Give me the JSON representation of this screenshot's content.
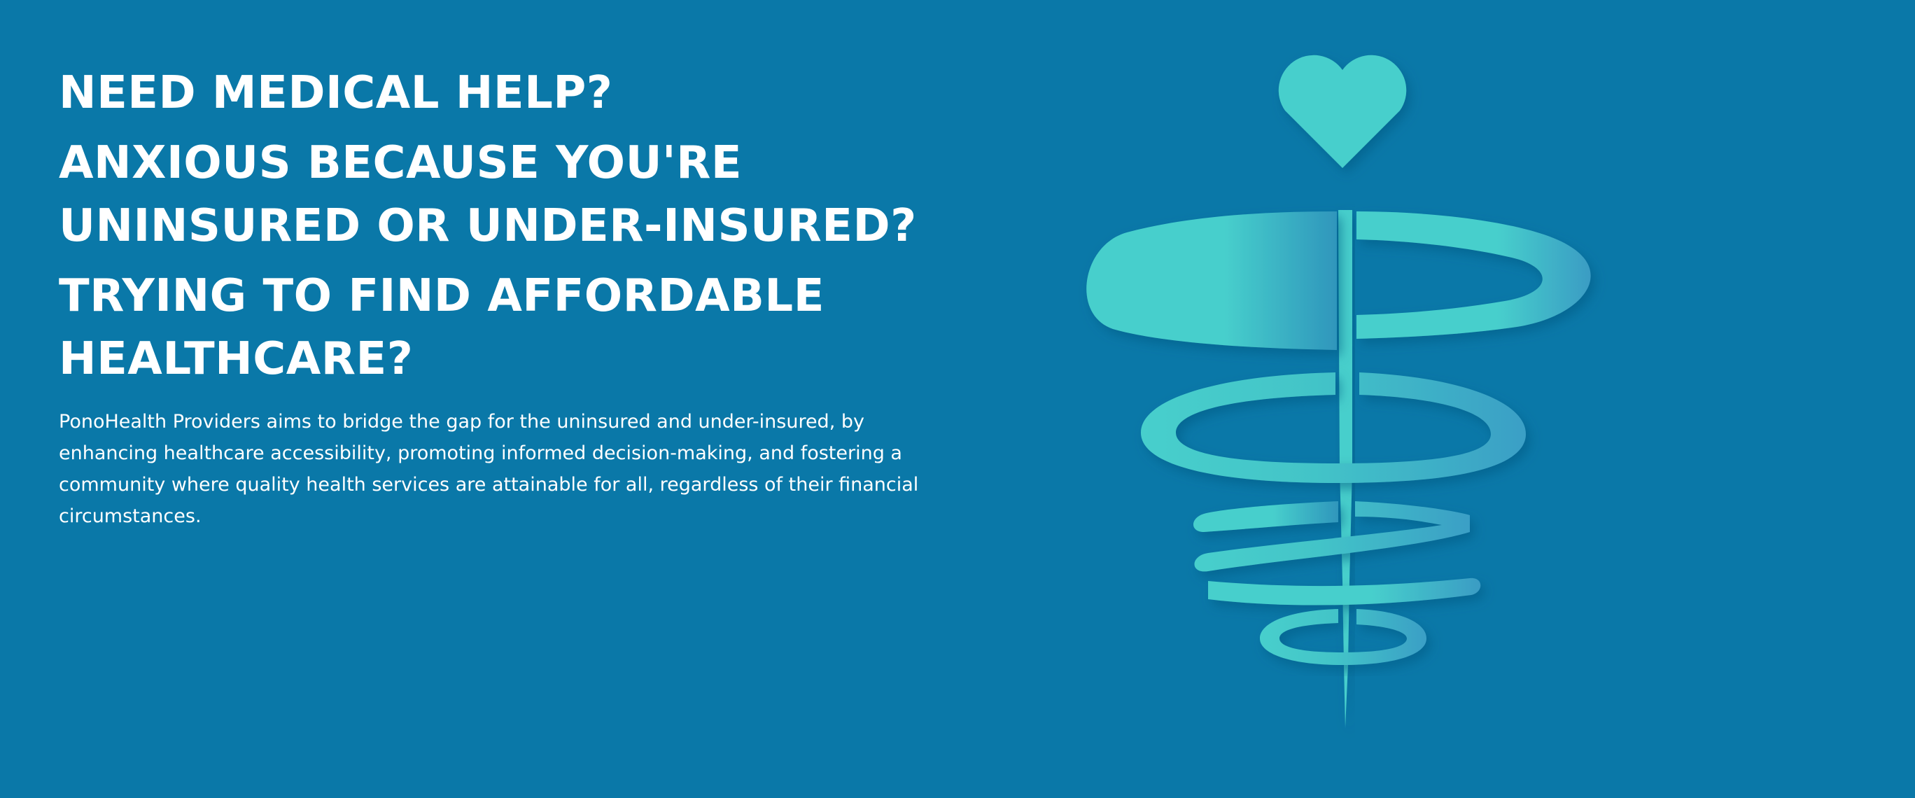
{
  "hero": {
    "headlines": [
      "NEED MEDICAL HELP?",
      "ANXIOUS BECAUSE YOU'RE UNINSURED OR UNDER-INSURED?",
      "TRYING TO FIND AFFORDABLE HEALTHCARE?"
    ],
    "description": "PonoHealth Providers aims to bridge the gap for the uninsured and under-insured, by enhancing healthcare accessibility, promoting informed decision-making, and fostering a community where quality health services are attainable for all, regardless of their financial circumstances."
  },
  "colors": {
    "background": "#0a78a8",
    "logo_teal": "#47cfcc",
    "logo_shadow": "#2a8fb4",
    "text": "#ffffff"
  },
  "logo": {
    "icon": "caduceus-heart-icon"
  }
}
